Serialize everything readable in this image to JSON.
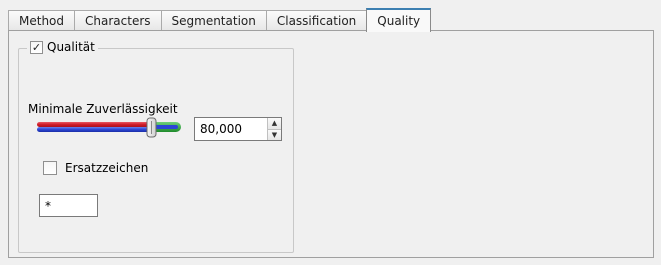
{
  "tabs": [
    {
      "label": "Method",
      "active": false
    },
    {
      "label": "Characters",
      "active": false
    },
    {
      "label": "Segmentation",
      "active": false
    },
    {
      "label": "Classification",
      "active": false
    },
    {
      "label": "Quality",
      "active": true
    }
  ],
  "quality_group": {
    "title": "Qualität",
    "checked": true,
    "min_reliability_label": "Minimale Zuverlässigkeit",
    "slider_value_percent": 80,
    "spin_value": "80,000",
    "replacement_label": "Ersatzzeichen",
    "replacement_checked": false,
    "replacement_char": "*"
  },
  "colors": {
    "accent": "#3c7fb1",
    "slider_red": "#d01c2a",
    "slider_blue": "#2b45d6",
    "slider_green": "#2fa23a"
  },
  "icons": {
    "check": "check-icon",
    "spin_up": "spin-up-icon",
    "spin_down": "spin-down-icon"
  }
}
